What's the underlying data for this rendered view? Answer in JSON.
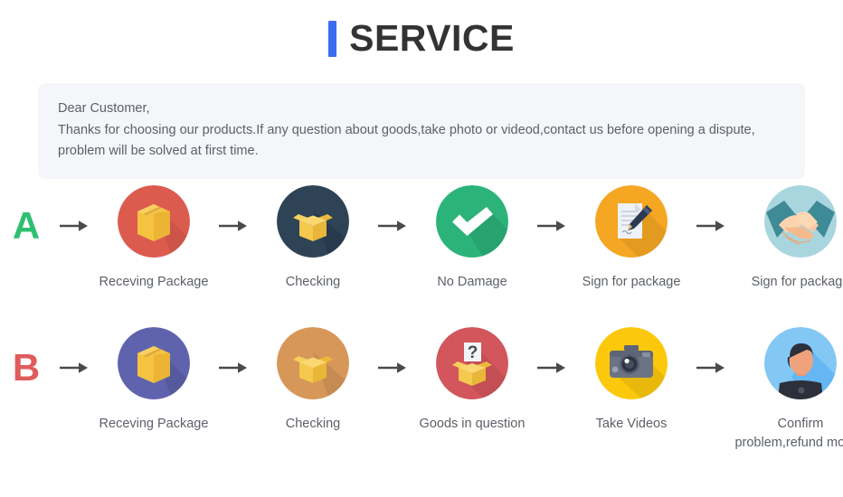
{
  "header": {
    "title": "SERVICE",
    "accent_color": "#3b6cf0"
  },
  "notice": {
    "line1": "Dear Customer,",
    "line2": "Thanks for choosing our products.If any question about goods,take photo or videod,contact us before opening a dispute,",
    "line3": "problem will be solved at first time.",
    "background_color": "#f5f6fa"
  },
  "flows": [
    {
      "letter": "A",
      "letter_color": "#2fbf71",
      "steps": [
        {
          "label": "Receving Package",
          "icon": "closed-box-icon",
          "circle_color": "#dc5b4f"
        },
        {
          "label": "Checking",
          "icon": "open-box-icon",
          "circle_color": "#2e4356"
        },
        {
          "label": "No Damage",
          "icon": "check-mark-icon",
          "circle_color": "#2cb37a"
        },
        {
          "label": "Sign for package",
          "icon": "document-pen-icon",
          "circle_color": "#f5a623"
        },
        {
          "label": "Sign for package",
          "icon": "handshake-icon",
          "circle_color": "#a9d6de"
        }
      ]
    },
    {
      "letter": "B",
      "letter_color": "#e05c5c",
      "steps": [
        {
          "label": "Receving Package",
          "icon": "closed-box-icon",
          "circle_color": "#5f63ad"
        },
        {
          "label": "Checking",
          "icon": "open-box-icon",
          "circle_color": "#d69759"
        },
        {
          "label": "Goods in question",
          "icon": "question-box-icon",
          "circle_color": "#d2565c"
        },
        {
          "label": "Take Videos",
          "icon": "camera-icon",
          "circle_color": "#fcc80b"
        },
        {
          "label": "Confirm  problem,refund money",
          "icon": "person-avatar-icon",
          "circle_color": "#83c7f5"
        }
      ]
    }
  ],
  "arrow": {
    "color": "#4a4a4a",
    "name": "arrow-right-icon"
  }
}
